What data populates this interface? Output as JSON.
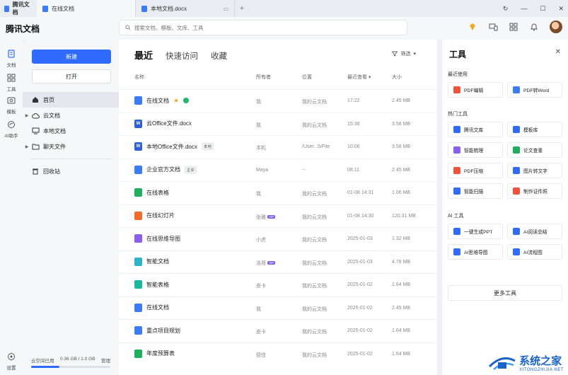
{
  "window": {
    "app_tab": "腾讯文档",
    "tabs": [
      {
        "label": "在线文档",
        "active": true
      },
      {
        "label": "本地文档.docx",
        "active": false
      }
    ]
  },
  "header": {
    "brand": "腾讯文档",
    "search_placeholder": "搜索文档、模板、文库、工具"
  },
  "rail": {
    "items": [
      {
        "label": "文档",
        "icon": "doc-icon"
      },
      {
        "label": "工具",
        "icon": "grid-icon"
      },
      {
        "label": "模板",
        "icon": "template-icon"
      },
      {
        "label": "AI助手",
        "icon": "ai-icon"
      }
    ],
    "settings": "设置"
  },
  "sidebar": {
    "new_label": "新建",
    "open_label": "打开",
    "nav": [
      {
        "label": "首页",
        "icon": "home-icon",
        "active": true,
        "caret": false
      },
      {
        "label": "云文档",
        "icon": "cloud-icon",
        "active": false,
        "caret": true
      },
      {
        "label": "本地文档",
        "icon": "monitor-icon",
        "active": false,
        "caret": false
      },
      {
        "label": "聊天文件",
        "icon": "folder-icon",
        "active": false,
        "caret": true
      }
    ],
    "trash": "回收站",
    "storage_label": "云空间已用",
    "storage_value": "0.36 GB / 1.0 GB",
    "storage_action": "管理",
    "storage_fraction": 0.36
  },
  "main": {
    "tabs": [
      {
        "label": "最近",
        "active": true
      },
      {
        "label": "快速访问",
        "active": false
      },
      {
        "label": "收藏",
        "active": false
      }
    ],
    "filter_label": "筛选",
    "columns": {
      "name": "名称",
      "owner": "所有者",
      "location": "位置",
      "last_viewed": "最近查看",
      "size": "大小"
    },
    "rows": [
      {
        "name": "在线文档",
        "color": "#3b7cf6",
        "glyph": "",
        "extra": "star",
        "owner": "我",
        "location": "我的云文档",
        "time": "17:22",
        "size": "2.45 MB"
      },
      {
        "name": "云Office文件.docx",
        "color": "#2f5fd8",
        "glyph": "W",
        "extra": "",
        "owner": "我",
        "location": "我的云文档",
        "time": "15:38",
        "size": "3.58 MB"
      },
      {
        "name": "本地Office文件.docx",
        "color": "#2f5fd8",
        "glyph": "W",
        "extra": "本地",
        "owner": "本机",
        "location": "/User...5/File",
        "time": "10:06",
        "size": "3.58 MB"
      },
      {
        "name": "企业官方文档",
        "color": "#3b7cf6",
        "glyph": "",
        "extra": "企业",
        "owner": "Maya",
        "location": "--",
        "time": "08:11",
        "size": "2.45 MB"
      },
      {
        "name": "在线表格",
        "color": "#1fae5c",
        "glyph": "",
        "extra": "",
        "owner": "我",
        "location": "我的云文档",
        "time": "01-08 14:31",
        "size": "1.06 MB"
      },
      {
        "name": "在线幻灯片",
        "color": "#f26b2a",
        "glyph": "",
        "extra": "",
        "owner": "张雅",
        "owner_vip": true,
        "location": "我的云文档",
        "time": "01-08 14:30",
        "size": "120.31 MB"
      },
      {
        "name": "在线思维导图",
        "color": "#8a5cf0",
        "glyph": "",
        "extra": "",
        "owner": "小虎",
        "location": "我的云文档",
        "time": "2025-01-03",
        "size": "1.32 MB"
      },
      {
        "name": "智能文档",
        "color": "#2cb5c8",
        "glyph": "",
        "extra": "",
        "owner": "浩哥",
        "owner_vip": true,
        "location": "我的云文档",
        "time": "2025-01-03",
        "size": "4.78 MB"
      },
      {
        "name": "智能表格",
        "color": "#19b6a0",
        "glyph": "",
        "extra": "",
        "owner": "皮卡",
        "location": "我的云文档",
        "time": "2025-01-02",
        "size": "1.64 MB"
      },
      {
        "name": "在线文档",
        "color": "#3b7cf6",
        "glyph": "",
        "extra": "",
        "owner": "我",
        "location": "我的云文档",
        "time": "2025-01-02",
        "size": "2.45 MB"
      },
      {
        "name": "重点项目规划",
        "color": "#3b7cf6",
        "glyph": "",
        "extra": "",
        "owner": "皮卡",
        "location": "我的云文档",
        "time": "2025-01-02",
        "size": "1.64 MB"
      },
      {
        "name": "年度预算表",
        "color": "#1fae5c",
        "glyph": "",
        "extra": "",
        "owner": "德佳",
        "location": "我的云文档",
        "time": "2025-01-02",
        "size": "1.64 MB"
      }
    ]
  },
  "panel": {
    "title": "工具",
    "sections": [
      {
        "title": "最近使用",
        "tools": [
          {
            "label": "PDF编辑",
            "color": "#f0533d"
          },
          {
            "label": "PDF转Word",
            "color": "#3b7cf6"
          }
        ]
      },
      {
        "title": "热门工具",
        "tools": [
          {
            "label": "腾讯文库",
            "color": "#2f6bff"
          },
          {
            "label": "模板库",
            "color": "#2f6bff"
          },
          {
            "label": "智能梳理",
            "color": "#8a5cf0"
          },
          {
            "label": "论文查重",
            "color": "#1fae5c"
          },
          {
            "label": "PDF压缩",
            "color": "#f0533d"
          },
          {
            "label": "图片转文字",
            "color": "#2f6bff"
          },
          {
            "label": "智能扫描",
            "color": "#2f6bff"
          },
          {
            "label": "制作证件照",
            "color": "#f0533d"
          }
        ]
      },
      {
        "title": "AI 工具",
        "tools": [
          {
            "label": "一键生成PPT",
            "color": "#2f6bff"
          },
          {
            "label": "AI阅读总结",
            "color": "#2f6bff"
          },
          {
            "label": "AI思维导图",
            "color": "#2f6bff"
          },
          {
            "label": "AI流程图",
            "color": "#2f6bff"
          }
        ]
      }
    ],
    "more_label": "更多工具"
  },
  "watermark": {
    "main": "系统之家",
    "sub": "XITONGZHIJIA.NET"
  }
}
